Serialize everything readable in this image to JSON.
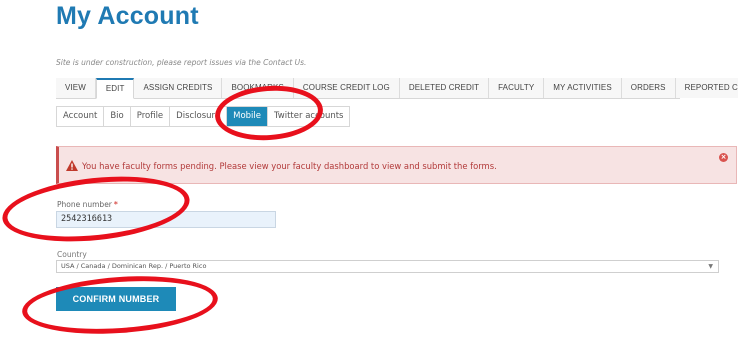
{
  "header": {
    "title": "My Account",
    "notice": "Site is under construction, please report issues via the Contact Us."
  },
  "primary_tabs": [
    {
      "label": "VIEW",
      "active": false
    },
    {
      "label": "EDIT",
      "active": true
    },
    {
      "label": "ASSIGN CREDITS",
      "active": false
    },
    {
      "label": "BOOKMARKS",
      "active": false
    },
    {
      "label": "COURSE CREDIT LOG",
      "active": false
    },
    {
      "label": "DELETED CREDIT",
      "active": false
    },
    {
      "label": "FACULTY",
      "active": false
    },
    {
      "label": "MY ACTIVITIES",
      "active": false
    },
    {
      "label": "ORDERS",
      "active": false
    },
    {
      "label": "REPORTED CREDIT",
      "active": false
    }
  ],
  "secondary_tabs": [
    {
      "label": "Account",
      "active": false
    },
    {
      "label": "Bio",
      "active": false
    },
    {
      "label": "Profile",
      "active": false
    },
    {
      "label": "Disclosure",
      "active": false
    },
    {
      "label": "Mobile",
      "active": true
    },
    {
      "label": "Twitter accounts",
      "active": false
    }
  ],
  "alert": {
    "message": "You have faculty forms pending. Please view your faculty dashboard to view and submit the forms.",
    "icon": "warning-triangle-icon",
    "close_icon": "close-circle-icon",
    "color": "#b23a3a"
  },
  "form": {
    "phone_label": "Phone number",
    "required_marker": "*",
    "phone_value": "2542316613",
    "country_label": "Country",
    "country_value": "USA / Canada / Dominican Rep. / Puerto Rico",
    "confirm_label": "CONFIRM NUMBER"
  },
  "colors": {
    "brand": "#1f7ab3",
    "button": "#1e8ab8",
    "annotation": "#e8101c"
  }
}
